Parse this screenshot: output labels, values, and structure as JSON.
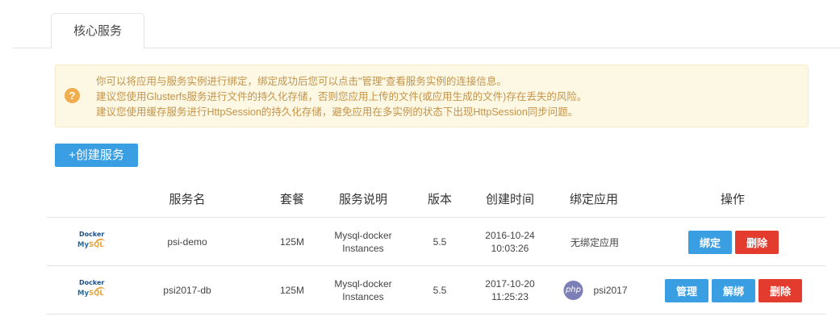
{
  "tabs": [
    {
      "label": "核心服务",
      "active": true
    }
  ],
  "notice": {
    "icon": "question-circle-icon",
    "lines": [
      "你可以将应用与服务实例进行绑定，绑定成功后您可以点击\"管理\"查看服务实例的连接信息。",
      "建议您使用Glusterfs服务进行文件的持久化存储，否则您应用上传的文件(或应用生成的文件)存在丢失的风险。",
      "建议您使用缓存服务进行HttpSession的持久化存储，避免应用在多实例的状态下出现HttpSession同步问题。"
    ]
  },
  "create_button": "+创建服务",
  "table": {
    "headers": [
      "服务名",
      "套餐",
      "服务说明",
      "版本",
      "创建时间",
      "绑定应用",
      "操作"
    ],
    "rows": [
      {
        "logo": {
          "line1": "Docker",
          "line2a": "My",
          "line2b": "SQL"
        },
        "name": "psi-demo",
        "plan": "125M",
        "desc1": "Mysql-docker",
        "desc2": "Instances",
        "version": "5.5",
        "date": "2016-10-24",
        "time": "10:03:26",
        "bound_app": "无绑定应用",
        "actions": [
          "绑定",
          "删除"
        ]
      },
      {
        "logo": {
          "line1": "Docker",
          "line2a": "My",
          "line2b": "SQL"
        },
        "name": "psi2017-db",
        "plan": "125M",
        "desc1": "Mysql-docker",
        "desc2": "Instances",
        "version": "5.5",
        "date": "2017-10-20",
        "time": "11:25:23",
        "bound_app_icon": "php",
        "bound_app": "psi2017",
        "actions": [
          "管理",
          "解绑",
          "删除"
        ]
      }
    ]
  },
  "colors": {
    "primary": "#3a9ee3",
    "danger": "#e43b2f",
    "notice_bg": "#fdf8e4",
    "notice_text": "#c4934a"
  }
}
